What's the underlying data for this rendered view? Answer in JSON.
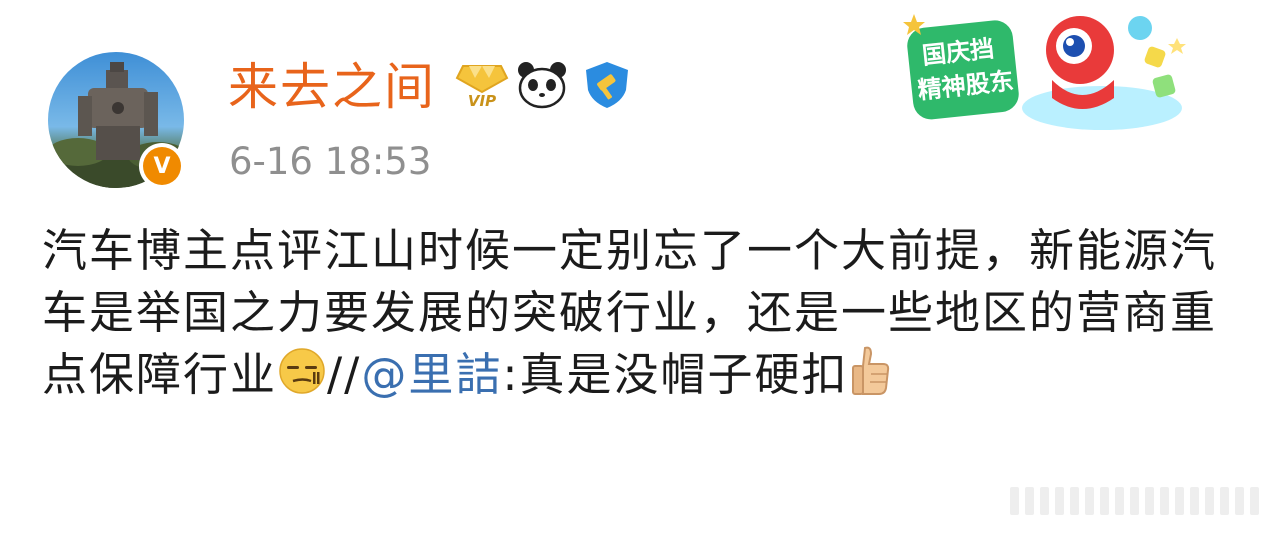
{
  "post": {
    "username": "来去之间",
    "vip_label": "VIP",
    "verified_label": "V",
    "timestamp": "6-16 18:53",
    "text_part1": "汽车博主点评江山时候一定别忘了一个大前提，新能源汽车是举国之力要发展的突破行业，还是一些地区的营商重点保障行业",
    "text_part2": "//",
    "mention": "@里詰",
    "text_part3": ":真是没帽子硬扣"
  },
  "festival_badge": {
    "line1": "国庆挡",
    "line2": "精神股东"
  },
  "icons": {
    "vip": "vip-diamond-icon",
    "panda": "panda-icon",
    "shield": "gavel-shield-icon",
    "smirk": "smirk-emoji-icon",
    "thumbs_up": "thumbs-up-emoji-icon"
  },
  "colors": {
    "username": "#e8641b",
    "mention": "#3a6fb0",
    "timestamp": "#8f8f8f",
    "text": "#1b1b1b",
    "verified": "#f08a00"
  }
}
